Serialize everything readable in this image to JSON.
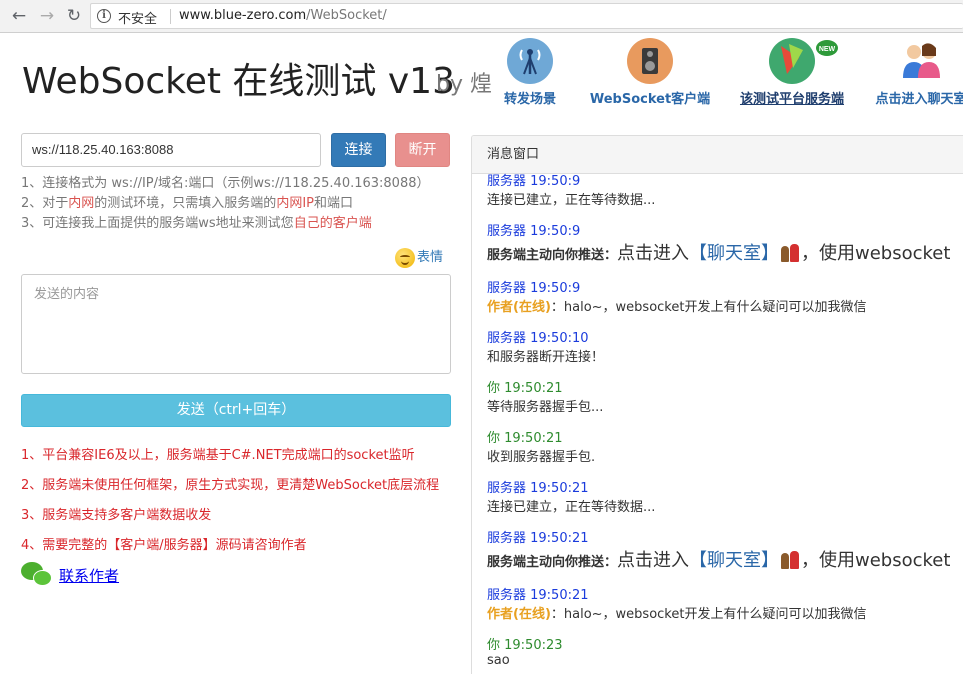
{
  "browser": {
    "insecure_label": "不安全",
    "url_host": "www.blue-zero.com",
    "url_path": "/WebSocket/"
  },
  "header": {
    "title": "WebSocket 在线测试 v13",
    "by": "by 煌",
    "nav": [
      {
        "label": "转发场景",
        "icon": "antenna-icon"
      },
      {
        "label": "WebSocket客户端",
        "icon": "speaker-icon"
      },
      {
        "label": "该测试平台服务端",
        "icon": "new-badge-icon"
      },
      {
        "label": "点击进入聊天室",
        "icon": "chat-users-icon"
      }
    ]
  },
  "connect": {
    "url_value": "ws://118.25.40.163:8088",
    "connect_label": "连接",
    "disconnect_label": "断开"
  },
  "hints": {
    "h1": "1、连接格式为 ws://IP/域名:端口（示例ws://118.25.40.163:8088）",
    "h2_a": "2、对于",
    "h2_b": "内网",
    "h2_c": "的测试环境，只需填入服务端的",
    "h2_d": "内网IP",
    "h2_e": "和端口",
    "h3_a": "3、可连接我上面提供的服务端ws地址来测试您",
    "h3_b": "自己的客户端"
  },
  "emoji_label": "表情",
  "send": {
    "placeholder": "发送的内容",
    "button_label": "发送（ctrl+回车）"
  },
  "notes": [
    "1、平台兼容IE6及以上，服务端基于C#.NET完成端口的socket监听",
    "2、服务端未使用任何框架，原生方式实现，更清楚WebSocket底层流程",
    "3、服务端支持多客户端数据收发",
    "4、需要完整的【客户端/服务器】源码请咨询作者"
  ],
  "contact_label": "联系作者",
  "panel_title": "消息窗口",
  "messages": [
    {
      "who": "服务器 19:50:9",
      "text": "连接已建立，正在等待数据..."
    },
    {
      "who": "服务器 19:50:9",
      "push_label": "服务端主动向你推送：",
      "push_a": "点击进入",
      "push_room": "【聊天室】",
      "push_b": "，使用websocket"
    },
    {
      "who": "服务器 19:50:9",
      "author": "作者(在线)",
      "text": "：halo~，websocket开发上有什么疑问可以加我微信"
    },
    {
      "who": "服务器 19:50:10",
      "text": "和服务器断开连接！"
    },
    {
      "who": "你 19:50:21",
      "text": "等待服务器握手包..."
    },
    {
      "who": "你 19:50:21",
      "text": "收到服务器握手包."
    },
    {
      "who": "服务器 19:50:21",
      "text": "连接已建立，正在等待数据..."
    },
    {
      "who": "服务器 19:50:21",
      "push_label": "服务端主动向你推送：",
      "push_a": "点击进入",
      "push_room": "【聊天室】",
      "push_b": "，使用websocket"
    },
    {
      "who": "服务器 19:50:21",
      "author": "作者(在线)",
      "text": "：halo~，websocket开发上有什么疑问可以加我微信"
    },
    {
      "who": "你 19:50:23",
      "text": "sao"
    }
  ]
}
